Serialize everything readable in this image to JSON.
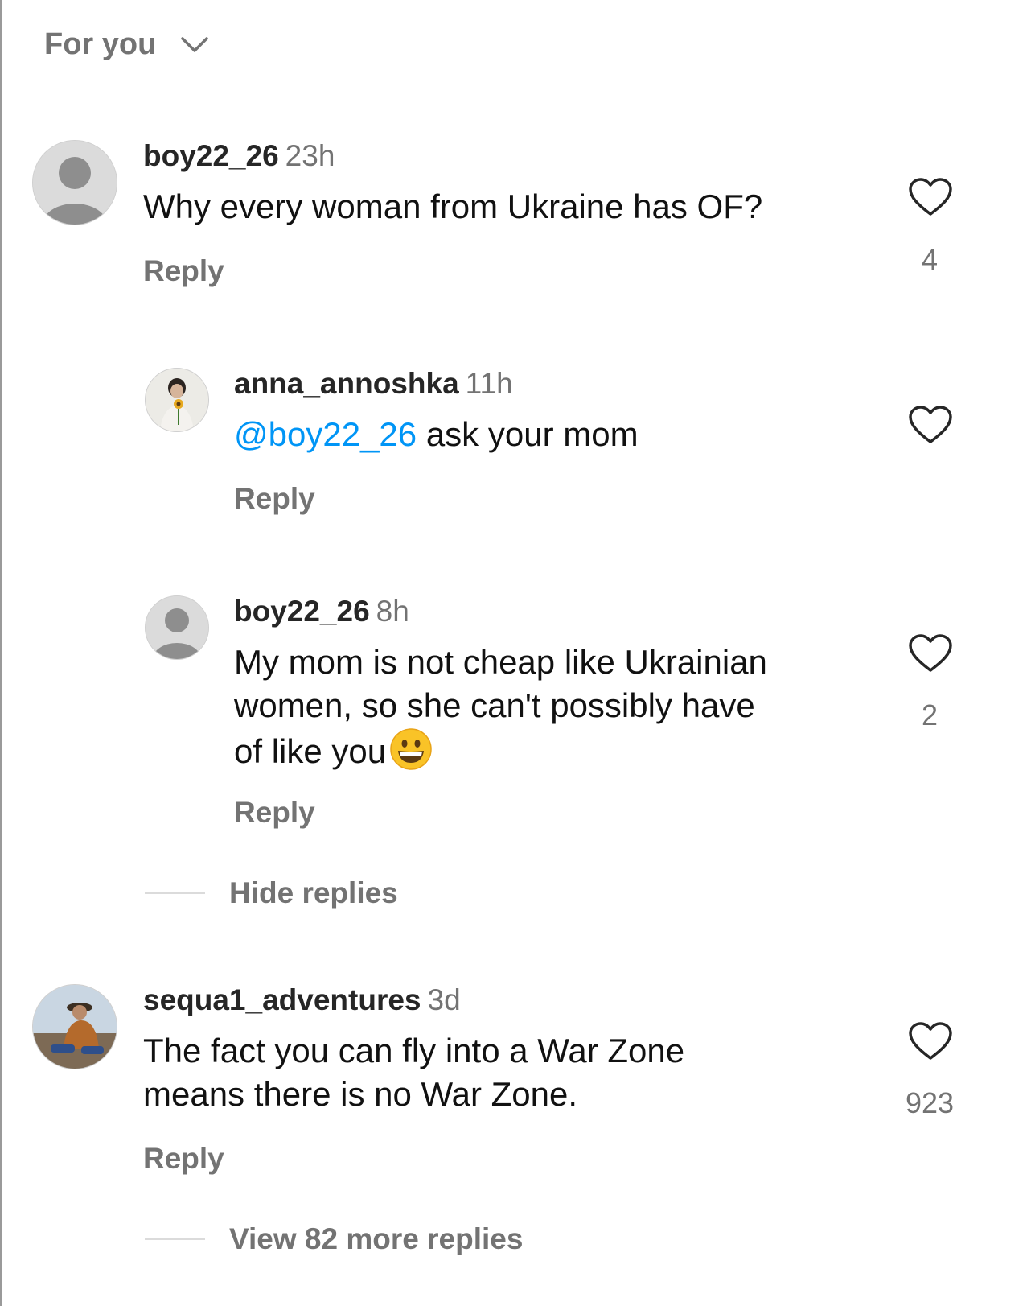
{
  "filter": {
    "label": "For you"
  },
  "comments": [
    {
      "username": "boy22_26",
      "time": "23h",
      "text": "Why every woman from Ukraine has OF?",
      "reply_label": "Reply",
      "likes": "4"
    },
    {
      "username": "anna_annoshka",
      "time": "11h",
      "mention": "@boy22_26",
      "text": " ask your mom",
      "reply_label": "Reply",
      "likes": ""
    },
    {
      "username": "boy22_26",
      "time": "8h",
      "text_lines": [
        "My mom is not cheap like Ukrainian",
        "women, so she can't possibly have",
        "of like you"
      ],
      "emoji": "grinning-face",
      "reply_label": "Reply",
      "likes": "2"
    },
    {
      "username": "sequa1_adventures",
      "time": "3d",
      "text_lines": [
        "The fact you can fly into a War Zone",
        "means there is no War Zone."
      ],
      "reply_label": "Reply",
      "likes": "923"
    }
  ],
  "hide_replies_label": "Hide replies",
  "view_more_label": "View 82 more replies",
  "colors": {
    "mention": "#0095f6",
    "secondary_text": "#737373",
    "primary_text": "#111111"
  }
}
